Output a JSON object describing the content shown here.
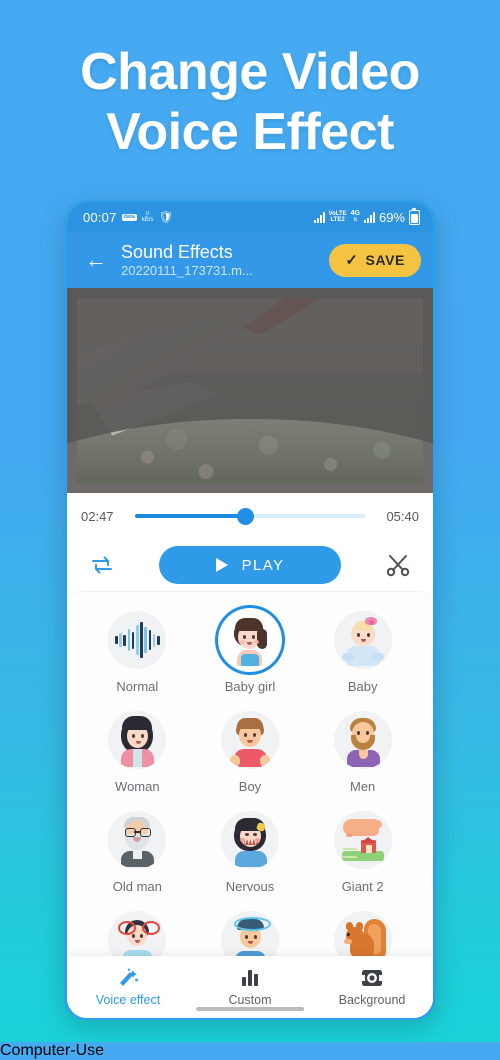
{
  "poster": {
    "headline_line1": "Change Video",
    "headline_line2": "Voice Effect",
    "background_top_color": "#45aaf2",
    "background_bottom_color": "#19d2d8"
  },
  "statusbar": {
    "time": "00:07",
    "chip_label": "data",
    "data_rate_value": "0",
    "data_rate_unit": "kB/s",
    "shield_icon": "shield-icon",
    "volte_top": "VoLTE",
    "volte_bottom": "LTE2",
    "network_type": "4G",
    "battery_percent": "69%"
  },
  "appbar": {
    "back_icon": "back-arrow-icon",
    "title": "Sound Effects",
    "subtitle": "20220111_173731.m...",
    "save_label": "SAVE",
    "save_check_icon": "check-icon",
    "save_color": "#f5c342",
    "bar_color": "#3498e8"
  },
  "player": {
    "current_time": "02:47",
    "total_time": "05:40",
    "progress_percent": 48,
    "loop_icon": "loop-icon",
    "play_label": "PLAY",
    "play_icon": "play-icon",
    "cut_icon": "scissors-icon",
    "accent_color": "#2f9ae8"
  },
  "effects": {
    "selected": "Baby girl",
    "items": [
      {
        "label": "Normal",
        "icon": "waveform-icon",
        "selected": false
      },
      {
        "label": "Baby girl",
        "icon": "baby-girl-icon",
        "selected": true
      },
      {
        "label": "Baby",
        "icon": "baby-icon",
        "selected": false
      },
      {
        "label": "Woman",
        "icon": "woman-icon",
        "selected": false
      },
      {
        "label": "Boy",
        "icon": "boy-icon",
        "selected": false
      },
      {
        "label": "Men",
        "icon": "men-icon",
        "selected": false
      },
      {
        "label": "Old man",
        "icon": "old-man-icon",
        "selected": false
      },
      {
        "label": "Nervous",
        "icon": "nervous-icon",
        "selected": false
      },
      {
        "label": "Giant 2",
        "icon": "giant-foot-icon",
        "selected": false
      },
      {
        "label": "",
        "icon": "dizzy-red-icon",
        "selected": false
      },
      {
        "label": "",
        "icon": "dizzy-blue-icon",
        "selected": false
      },
      {
        "label": "",
        "icon": "squirrel-icon",
        "selected": false
      }
    ]
  },
  "bottomnav": {
    "items": [
      {
        "label": "Voice effect",
        "icon": "magic-wand-icon",
        "active": true
      },
      {
        "label": "Custom",
        "icon": "equalizer-icon",
        "active": false
      },
      {
        "label": "Background",
        "icon": "camera-icon",
        "active": false
      }
    ],
    "active_color": "#2f9ae8"
  }
}
